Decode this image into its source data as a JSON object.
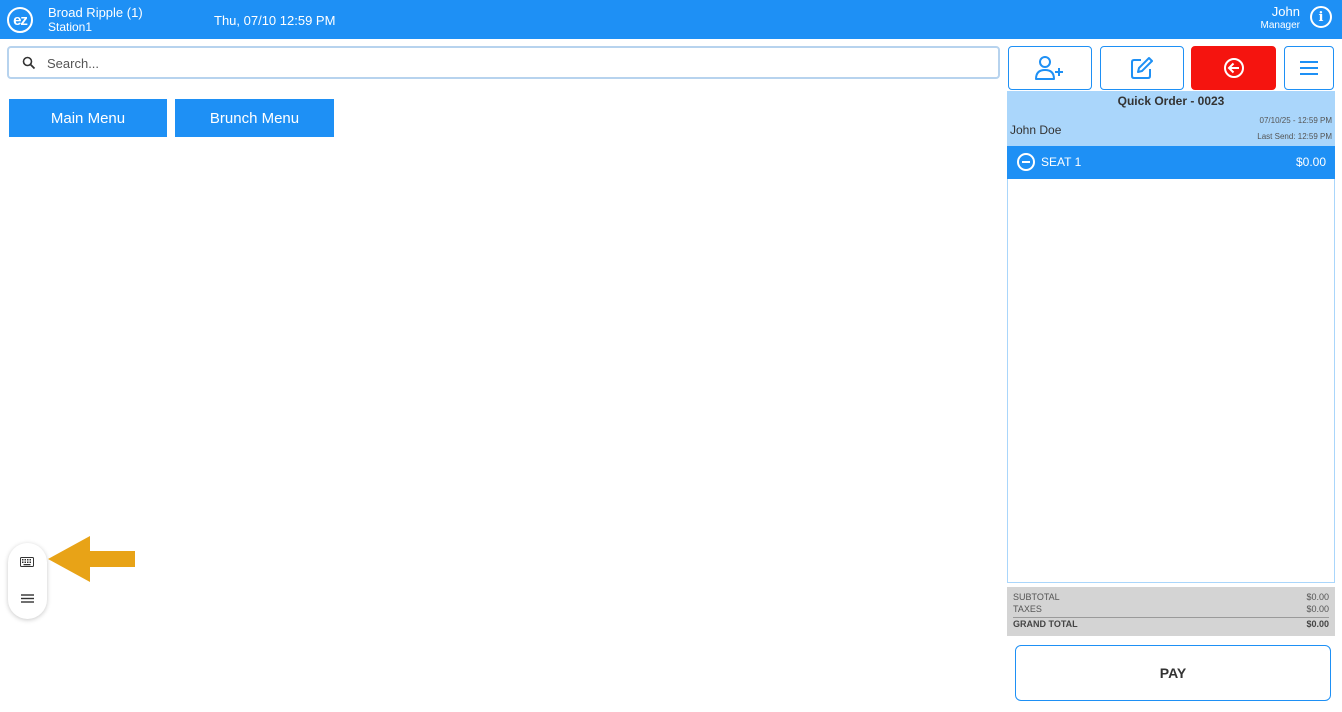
{
  "header": {
    "logo_text": "ez",
    "location": "Broad Ripple (1)",
    "station": "Station1",
    "datetime": "Thu, 07/10 12:59 PM",
    "user_name": "John",
    "user_role": "Manager",
    "info_icon": "i"
  },
  "search": {
    "placeholder": "Search...",
    "value": ""
  },
  "actions": {
    "add_customer_icon": "user-plus-icon",
    "edit_icon": "edit-icon",
    "back_icon": "back-arrow-icon",
    "menu_icon": "hamburger-icon"
  },
  "menus": [
    {
      "label": "Main Menu"
    },
    {
      "label": "Brunch Menu"
    }
  ],
  "order": {
    "title": "Quick Order - 0023",
    "customer": "John Doe",
    "date": "07/10/25 - 12:59 PM",
    "last_send": "Last Send: 12:59 PM",
    "seat_label": "SEAT 1",
    "seat_total": "$0.00"
  },
  "totals": {
    "subtotal_label": "SUBTOTAL",
    "subtotal": "$0.00",
    "taxes_label": "TAXES",
    "taxes": "$0.00",
    "grand_total_label": "GRAND TOTAL",
    "grand_total": "$0.00"
  },
  "pay_label": "PAY",
  "colors": {
    "primary": "#1e90f5",
    "danger": "#f5140f",
    "header_light": "#aad6fb",
    "annotation": "#e8a317"
  }
}
